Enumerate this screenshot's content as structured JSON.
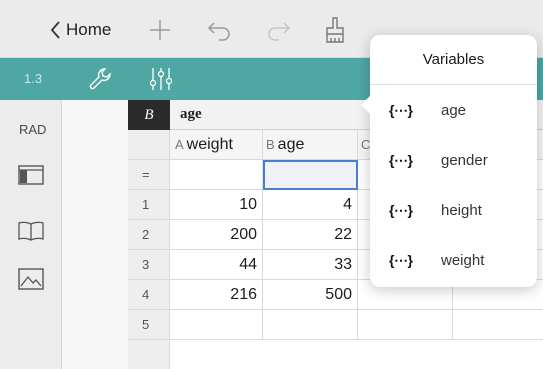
{
  "nav": {
    "back_label": "Home",
    "icons": [
      "chevron-left-icon",
      "plus-icon",
      "undo-icon",
      "redo-icon",
      "clear-brush-icon"
    ]
  },
  "toolbar": {
    "page_number": "1.3",
    "icons": [
      "wrench-icon",
      "sliders-icon"
    ],
    "accent_color": "#4fa7a4"
  },
  "sidebar": {
    "mode_label": "RAD",
    "icons": [
      "page-layout-icon",
      "book-icon",
      "image-icon"
    ]
  },
  "sheet": {
    "cell_name": "B",
    "cell_value": "age",
    "formula_row_label": "=",
    "columns": [
      {
        "letter": "A",
        "name": "weight"
      },
      {
        "letter": "B",
        "name": "age"
      },
      {
        "letter": "C",
        "name": ""
      }
    ],
    "rows": [
      {
        "index": "1",
        "weight": "10",
        "age": "4"
      },
      {
        "index": "2",
        "weight": "200",
        "age": "22"
      },
      {
        "index": "3",
        "weight": "44",
        "age": "33"
      },
      {
        "index": "4",
        "weight": "216",
        "age": "500"
      },
      {
        "index": "5",
        "weight": "",
        "age": ""
      }
    ]
  },
  "variables_popover": {
    "title": "Variables",
    "icon_glyph": "{⋯}",
    "items": [
      "age",
      "gender",
      "height",
      "weight"
    ]
  }
}
